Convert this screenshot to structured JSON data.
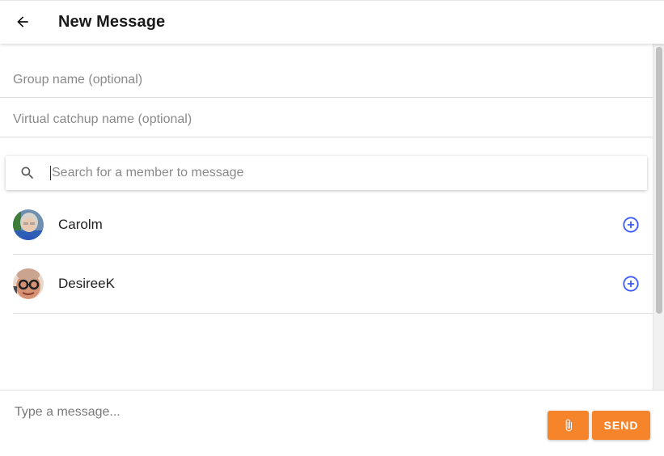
{
  "header": {
    "title": "New Message",
    "back_icon": "arrow-left-icon"
  },
  "form": {
    "group_name_placeholder": "Group name (optional)",
    "group_name_value": "",
    "catchup_name_placeholder": "Virtual catchup name (optional)",
    "catchup_name_value": "",
    "search_placeholder": "Search for a member to message",
    "search_value": ""
  },
  "members": [
    {
      "name": "Carolm",
      "avatar": "avatar-carolm",
      "action_icon": "add-circle-icon"
    },
    {
      "name": "DesireeK",
      "avatar": "avatar-desireek",
      "action_icon": "add-circle-icon"
    }
  ],
  "composer": {
    "placeholder": "Type a message...",
    "value": "",
    "attach_icon": "paperclip-icon",
    "send_label": "SEND"
  },
  "colors": {
    "accent": "#f5842b",
    "add_icon": "#3d5afe"
  }
}
